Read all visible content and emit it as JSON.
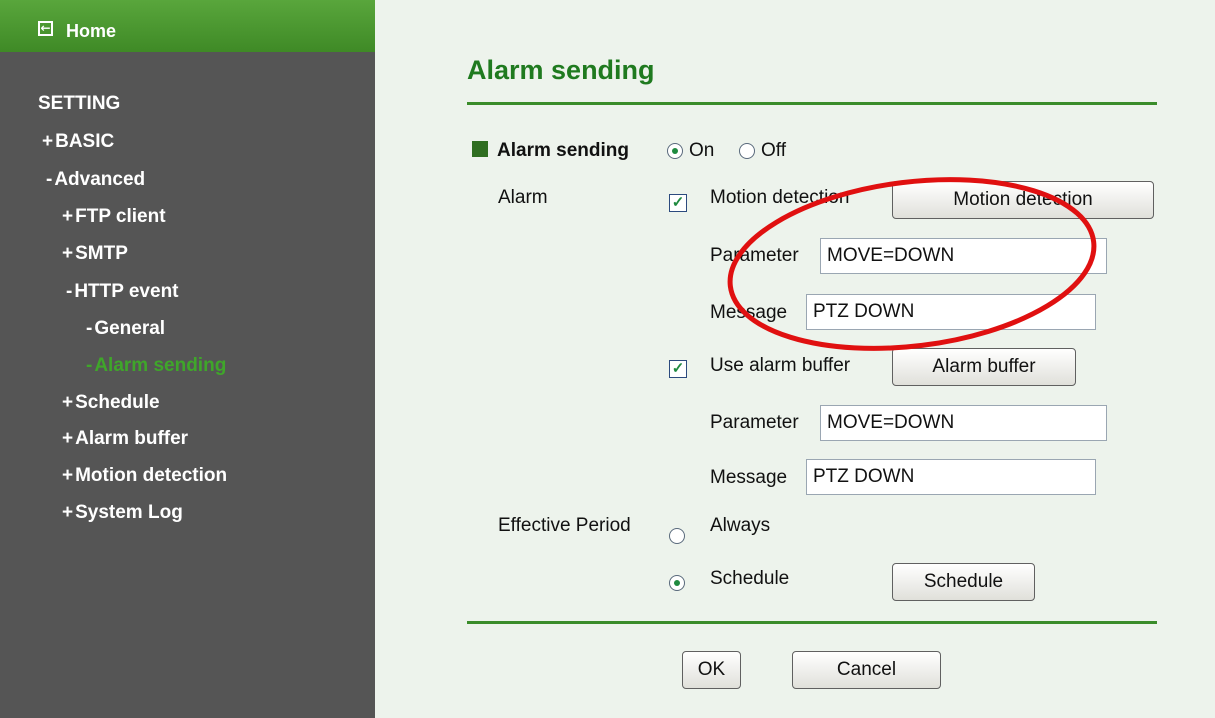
{
  "sidebar": {
    "home_label": "Home",
    "section_title": "SETTING",
    "items": [
      {
        "symbol": "+",
        "label": "BASIC"
      },
      {
        "symbol": "-",
        "label": "Advanced"
      },
      {
        "symbol": "+",
        "label": "FTP client"
      },
      {
        "symbol": "+",
        "label": "SMTP"
      },
      {
        "symbol": "-",
        "label": "HTTP event"
      },
      {
        "symbol": "-",
        "label": "General"
      },
      {
        "symbol": "-",
        "label": "Alarm sending"
      },
      {
        "symbol": "+",
        "label": "Schedule"
      },
      {
        "symbol": "+",
        "label": "Alarm buffer"
      },
      {
        "symbol": "+",
        "label": "Motion detection"
      },
      {
        "symbol": "+",
        "label": "System Log"
      }
    ]
  },
  "main": {
    "title": "Alarm sending",
    "alarm_sending": {
      "label": "Alarm sending",
      "on": "On",
      "off": "Off",
      "selected": "On"
    },
    "alarm": {
      "label": "Alarm",
      "motion": {
        "checked": true,
        "label": "Motion detection",
        "button": "Motion detection",
        "parameter_label": "Parameter",
        "parameter_value": "MOVE=DOWN",
        "message_label": "Message",
        "message_value": "PTZ DOWN"
      },
      "buffer": {
        "checked": true,
        "label": "Use alarm buffer",
        "button": "Alarm buffer",
        "parameter_label": "Parameter",
        "parameter_value": "MOVE=DOWN",
        "message_label": "Message",
        "message_value": "PTZ DOWN"
      }
    },
    "effective_period": {
      "label": "Effective Period",
      "always": "Always",
      "schedule": "Schedule",
      "selected": "Schedule",
      "button": "Schedule"
    },
    "ok": "OK",
    "cancel": "Cancel"
  },
  "colors": {
    "accent_green": "#1f7a1f",
    "sidebar_bg": "#555555",
    "active_item": "#3fa62a",
    "annotation_red": "#e01010"
  }
}
